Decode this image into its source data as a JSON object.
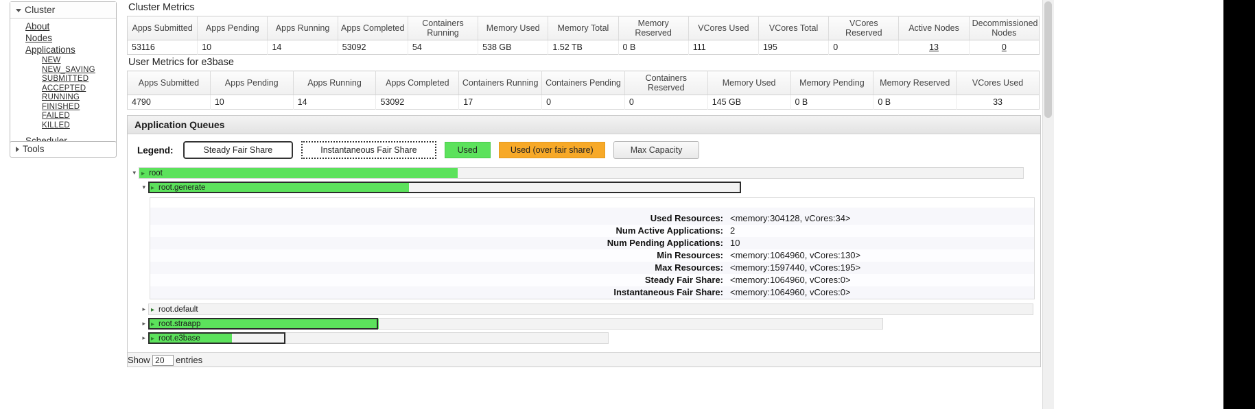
{
  "sidebar": {
    "cluster": {
      "label": "Cluster",
      "items": [
        {
          "label": "About"
        },
        {
          "label": "Nodes"
        },
        {
          "label": "Applications"
        }
      ],
      "app_states": [
        {
          "label": "NEW"
        },
        {
          "label": "NEW_SAVING"
        },
        {
          "label": "SUBMITTED"
        },
        {
          "label": "ACCEPTED"
        },
        {
          "label": "RUNNING"
        },
        {
          "label": "FINISHED"
        },
        {
          "label": "FAILED"
        },
        {
          "label": "KILLED"
        }
      ],
      "scheduler": {
        "label": "Scheduler"
      }
    },
    "tools": {
      "label": "Tools"
    }
  },
  "cluster_metrics": {
    "title": "Cluster Metrics",
    "headers": [
      "Apps Submitted",
      "Apps Pending",
      "Apps Running",
      "Apps Completed",
      "Containers Running",
      "Memory Used",
      "Memory Total",
      "Memory Reserved",
      "VCores Used",
      "VCores Total",
      "VCores Reserved",
      "Active Nodes",
      "Decommissioned Nodes"
    ],
    "values": [
      "53116",
      "10",
      "14",
      "53092",
      "54",
      "538 GB",
      "1.52 TB",
      "0 B",
      "111",
      "195",
      "0",
      "13",
      "0"
    ],
    "link_indexes": [
      11,
      12
    ]
  },
  "user_metrics": {
    "title": "User Metrics for e3base",
    "headers": [
      "Apps Submitted",
      "Apps Pending",
      "Apps Running",
      "Apps Completed",
      "Containers Running",
      "Containers Pending",
      "Containers Reserved",
      "Memory Used",
      "Memory Pending",
      "Memory Reserved",
      "VCores Used"
    ],
    "values": [
      "4790",
      "10",
      "14",
      "53092",
      "17",
      "0",
      "0",
      "145 GB",
      "0 B",
      "0 B",
      "33"
    ]
  },
  "queues": {
    "panel_title": "Application Queues",
    "legend": {
      "label": "Legend:",
      "steady": "Steady Fair Share",
      "instantaneous": "Instantaneous Fair Share",
      "used": "Used",
      "used_over": "Used (over fair share)",
      "max_capacity": "Max Capacity"
    },
    "tree": [
      {
        "name": "root",
        "expanded": true,
        "depth": 0,
        "bar_total_pct": 100,
        "used_pct": 36.0,
        "steady_pct": 0,
        "inst_pct": 0
      },
      {
        "name": "root.generate",
        "expanded": true,
        "depth": 1,
        "bar_total_pct": 67,
        "used_pct": 29.4,
        "steady_pct": 0,
        "inst_pct": 67
      },
      {
        "name": "root.default",
        "expanded": false,
        "depth": 1,
        "bar_total_pct": 0,
        "used_pct": 0,
        "steady_pct": 0,
        "inst_pct": 0
      },
      {
        "name": "root.straapp",
        "expanded": false,
        "depth": 1,
        "bar_total_pct": 83,
        "used_pct": 26.0,
        "steady_pct": 0,
        "inst_pct": 26.0
      },
      {
        "name": "root.e3base",
        "expanded": false,
        "depth": 1,
        "bar_total_pct": 52,
        "used_pct": 9.4,
        "steady_pct": 0,
        "inst_pct": 15.5
      }
    ],
    "detail": {
      "rows": [
        {
          "key": "Used Resources:",
          "value": "<memory:304128, vCores:34>"
        },
        {
          "key": "Num Active Applications:",
          "value": "2"
        },
        {
          "key": "Num Pending Applications:",
          "value": "10"
        },
        {
          "key": "Min Resources:",
          "value": "<memory:1064960, vCores:130>"
        },
        {
          "key": "Max Resources:",
          "value": "<memory:1597440, vCores:195>"
        },
        {
          "key": "Steady Fair Share:",
          "value": "<memory:1064960, vCores:0>"
        },
        {
          "key": "Instantaneous Fair Share:",
          "value": "<memory:1064960, vCores:0>"
        }
      ]
    }
  },
  "footer": {
    "show_prefix": "Show",
    "entries_count": "20",
    "show_suffix": "entries"
  },
  "colors": {
    "used_green": "#5ce25c",
    "over_orange": "#f7a928",
    "panel_border": "#c9c9c9"
  }
}
